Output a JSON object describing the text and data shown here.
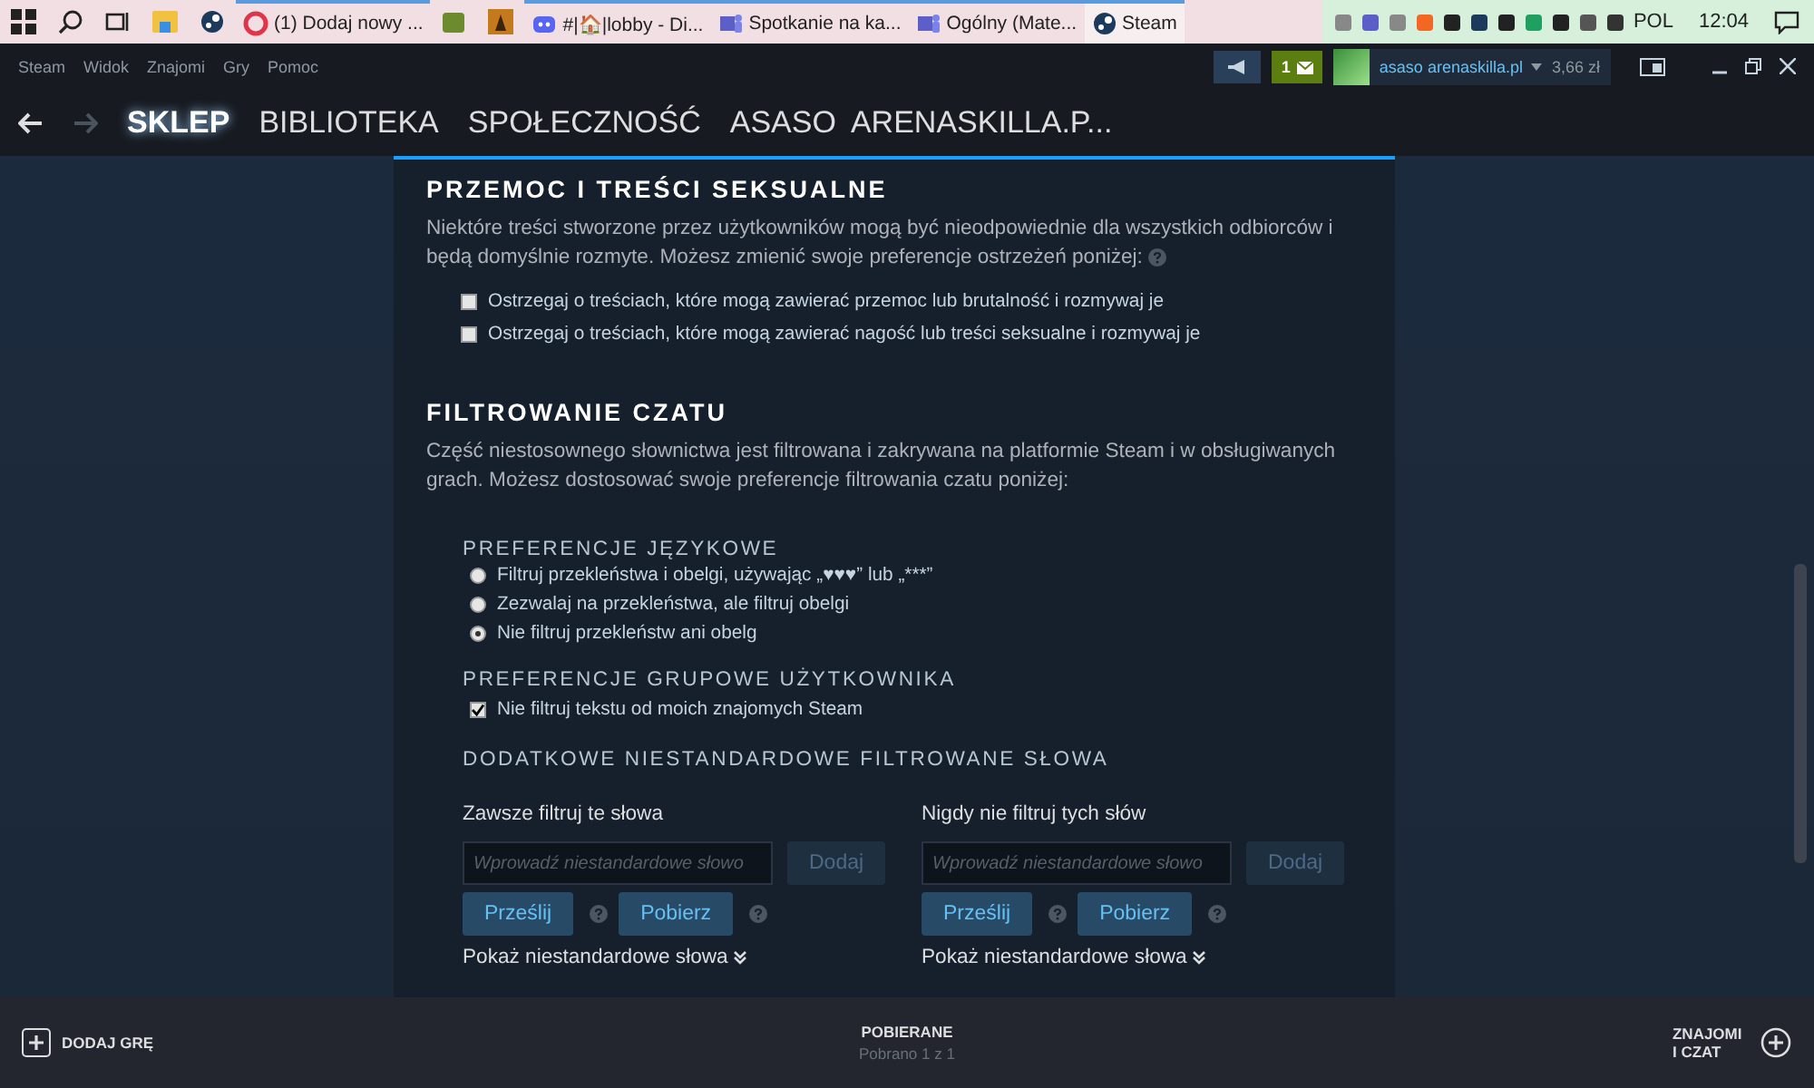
{
  "taskbar": {
    "tasks": [
      {
        "label": "(1) Dodaj nowy ...",
        "kind": "opera",
        "open": true
      },
      {
        "label": "#|🏠|lobby - Di...",
        "kind": "discord",
        "open": true
      },
      {
        "label": "Spotkanie na ka...",
        "kind": "teams",
        "open": true
      },
      {
        "label": "Ogólny (Mate...",
        "kind": "teams",
        "open": true
      },
      {
        "label": "Steam",
        "kind": "steam",
        "open": true
      }
    ],
    "language": "POL",
    "time": "12:04"
  },
  "menu": [
    "Steam",
    "Widok",
    "Znajomi",
    "Gry",
    "Pomoc"
  ],
  "account": {
    "notifications": "1",
    "username": "asaso",
    "domain": "arenaskilla.pl",
    "balance": "3,66 zł"
  },
  "nav_tabs": [
    {
      "label": "SKLEP",
      "selected": true
    },
    {
      "label": "BIBLIOTEKA",
      "selected": false
    },
    {
      "label": "SPOŁECZNOŚĆ",
      "selected": false
    },
    {
      "label": "ASASO",
      "selected": false
    },
    {
      "label": "ARENASKILLA.P...",
      "selected": false
    }
  ],
  "content_sections": [
    {
      "title": "PRZEMOC I TREŚCI SEKSUALNE",
      "description": "Niektóre treści stworzone przez użytkowników mogą być nieodpowiednie dla wszystkich odbiorców i będą domyślnie rozmyte. Możesz zmienić swoje preferencje ostrzeżeń poniżej:",
      "help": true,
      "checkboxes": [
        {
          "label": "Ostrzegaj o treściach, które mogą zawierać przemoc lub brutalność i rozmywaj je",
          "checked": false
        },
        {
          "label": "Ostrzegaj o treściach, które mogą zawierać nagość lub treści seksualne i rozmywaj je",
          "checked": false
        }
      ]
    },
    {
      "title": "FILTROWANIE CZATU",
      "description": "Część niestosownego słownictwa jest filtrowana i zakrywana na platformie Steam i w obsługiwanych grach. Możesz dostosować swoje preferencje filtrowania czatu poniżej:",
      "help": false
    }
  ],
  "language_preferences": {
    "title": "PREFERENCJE JĘZYKOWE",
    "options": [
      {
        "label": "Filtruj przekleństwa i obelgi, używając „♥♥♥” lub „***”",
        "selected": false
      },
      {
        "label": "Zezwalaj na przekleństwa, ale filtruj obelgi",
        "selected": false
      },
      {
        "label": "Nie filtruj przekleństw ani obelg",
        "selected": true
      }
    ]
  },
  "group_preferences": {
    "title": "PREFERENCJE GRUPOWE UŻYTKOWNIKA",
    "options": [
      {
        "label": "Nie filtruj tekstu od moich znajomych Steam",
        "checked": true
      }
    ]
  },
  "custom_words": {
    "title": "DODATKOWE NIESTANDARDOWE FILTROWANE SŁOWA",
    "columns": [
      {
        "heading": "Zawsze filtruj te słowa",
        "placeholder": "Wprowadź niestandardowe słowo",
        "add": "Dodaj",
        "upload": "Prześlij",
        "download": "Pobierz",
        "show": "Pokaż niestandardowe słowa"
      },
      {
        "heading": "Nigdy nie filtruj tych słów",
        "placeholder": "Wprowadź niestandardowe słowo",
        "add": "Dodaj",
        "upload": "Prześlij",
        "download": "Pobierz",
        "show": "Pokaż niestandardowe słowa"
      }
    ]
  },
  "footer": {
    "add_game": "DODAJ GRĘ",
    "downloads_title": "POBIERANE",
    "downloads_status": "Pobrano 1 z 1",
    "friends": "ZNAJOMI I CZAT"
  }
}
